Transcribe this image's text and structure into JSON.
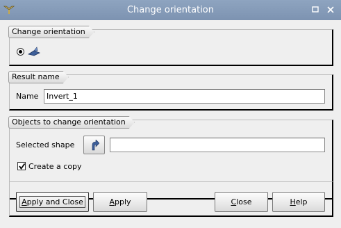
{
  "window": {
    "title": "Change orientation"
  },
  "groups": {
    "orientation": {
      "title": "Change orientation"
    },
    "result": {
      "title": "Result name",
      "name_label": "Name",
      "name_value": "Invert_1"
    },
    "objects": {
      "title": "Objects to change orientation",
      "selected_shape_label": "Selected shape",
      "selected_shape_value": "",
      "create_copy_label": "Create a copy",
      "create_copy_checked": true
    }
  },
  "buttons": {
    "apply_and_close": {
      "label": "Apply and Close",
      "mnemonic": "A"
    },
    "apply": {
      "label": "Apply",
      "mnemonic": "A"
    },
    "close": {
      "label": "Close",
      "mnemonic": "C"
    },
    "help": {
      "label": "Help",
      "mnemonic": "H"
    }
  },
  "icons": {
    "app": "geometry-app-icon",
    "minimize": "minimize-icon",
    "close": "close-icon",
    "orientation": "change-orientation-icon",
    "select": "select-arrow-icon"
  },
  "colors": {
    "titlebar": "#8ea4c0",
    "accent_blue": "#3d5f99"
  }
}
